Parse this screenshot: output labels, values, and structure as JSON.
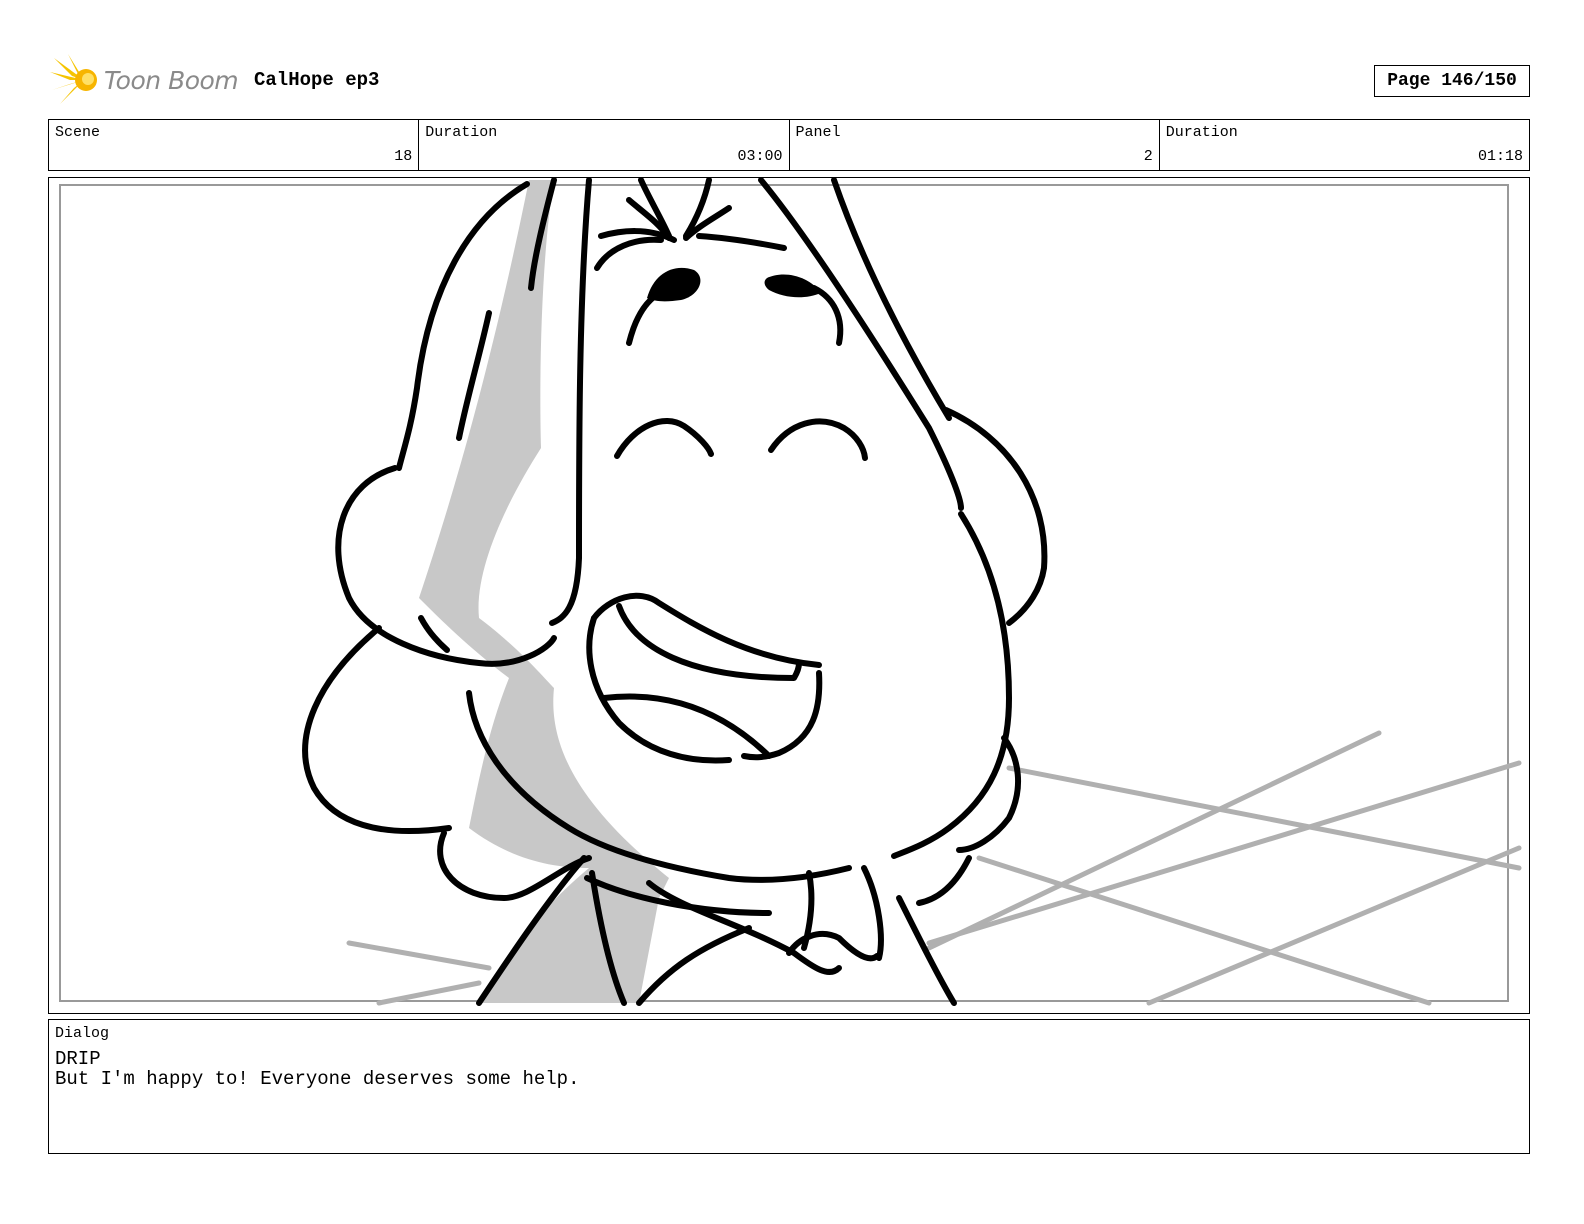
{
  "header": {
    "logo_text": "Toon Boom",
    "project_title": "CalHope ep3",
    "page_label": "Page 146/150"
  },
  "info": {
    "scene_label": "Scene",
    "scene_value": "18",
    "scene_duration_label": "Duration",
    "scene_duration_value": "03:00",
    "panel_label": "Panel",
    "panel_value": "2",
    "panel_duration_label": "Duration",
    "panel_duration_value": "01:18"
  },
  "dialog": {
    "label": "Dialog",
    "speaker": "DRIP",
    "line": "But I'm happy to! Everyone deserves some help."
  },
  "colors": {
    "logo_accent": "#f5c400",
    "sketch_ink": "#000000",
    "sketch_shadow": "#c8c8c8",
    "frame_gray": "#999999"
  },
  "icons": {
    "logo": "toon-boom-burst-icon"
  }
}
